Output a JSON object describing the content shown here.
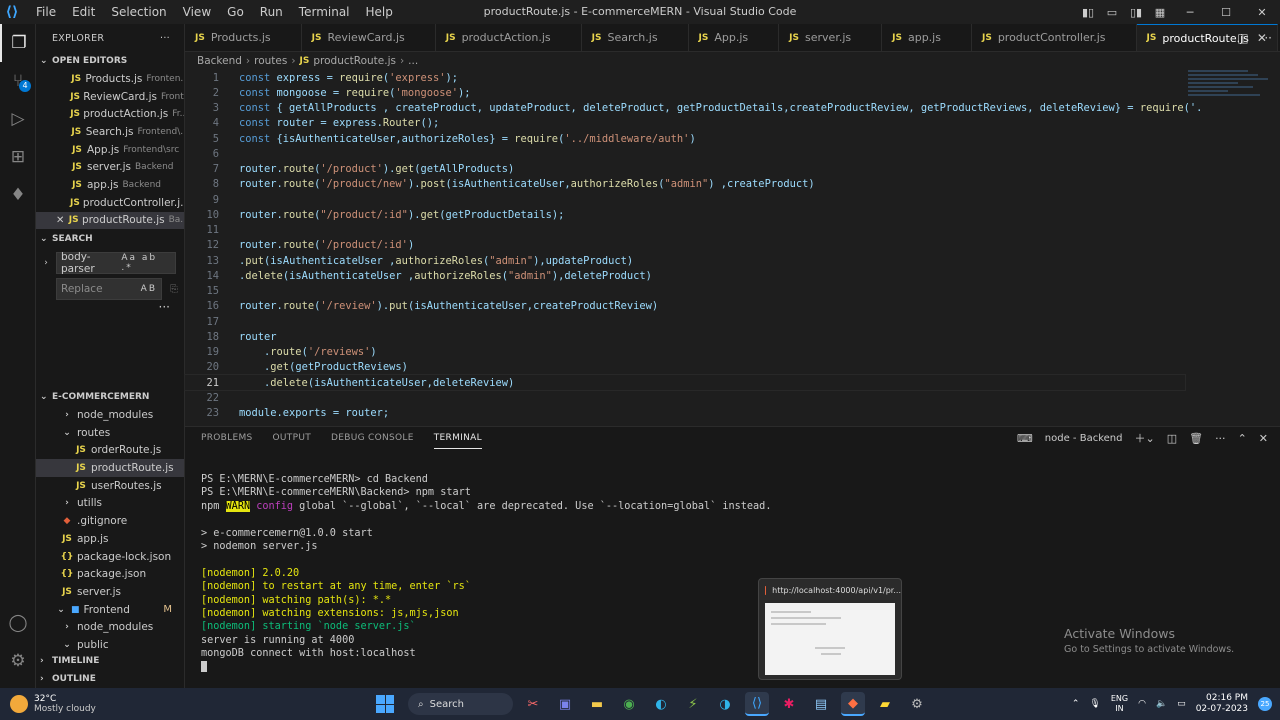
{
  "window": {
    "title": "productRoute.js - E-commerceMERN - Visual Studio Code",
    "menu": [
      "File",
      "Edit",
      "Selection",
      "View",
      "Go",
      "Run",
      "Terminal",
      "Help"
    ]
  },
  "sidebar": {
    "explorer_label": "EXPLORER",
    "open_editors_label": "OPEN EDITORS",
    "open_editors": [
      {
        "name": "Products.js",
        "path": "Fronten..."
      },
      {
        "name": "ReviewCard.js",
        "path": "Front..."
      },
      {
        "name": "productAction.js",
        "path": "Fr..."
      },
      {
        "name": "Search.js",
        "path": "Frontend\\..."
      },
      {
        "name": "App.js",
        "path": "Frontend\\src"
      },
      {
        "name": "server.js",
        "path": "Backend"
      },
      {
        "name": "app.js",
        "path": "Backend"
      },
      {
        "name": "productController.j...",
        "path": ""
      },
      {
        "name": "productRoute.js",
        "path": "Ba..."
      }
    ],
    "search_label": "SEARCH",
    "search_value": "body-parser",
    "search_opts": "Aa ab .*",
    "replace_placeholder": "Replace",
    "replace_opt": "AB",
    "project_label": "E-COMMERCEMERN",
    "tree": [
      {
        "name": "node_modules",
        "kind": "folder",
        "depth": 1
      },
      {
        "name": "routes",
        "kind": "folder-open",
        "depth": 1
      },
      {
        "name": "orderRoute.js",
        "kind": "js",
        "depth": 2
      },
      {
        "name": "productRoute.js",
        "kind": "js",
        "depth": 2
      },
      {
        "name": "userRoutes.js",
        "kind": "js",
        "depth": 2
      },
      {
        "name": "utills",
        "kind": "folder",
        "depth": 1
      },
      {
        "name": ".gitignore",
        "kind": "git",
        "depth": 1
      },
      {
        "name": "app.js",
        "kind": "js",
        "depth": 1
      },
      {
        "name": "package-lock.json",
        "kind": "json",
        "depth": 1
      },
      {
        "name": "package.json",
        "kind": "json",
        "depth": 1
      },
      {
        "name": "server.js",
        "kind": "js",
        "depth": 1
      },
      {
        "name": "Frontend",
        "kind": "folder-root",
        "depth": 0,
        "badge": "M"
      },
      {
        "name": "node_modules",
        "kind": "folder",
        "depth": 1
      },
      {
        "name": "public",
        "kind": "folder-open",
        "depth": 1
      }
    ],
    "timeline_label": "TIMELINE",
    "outline_label": "OUTLINE"
  },
  "tabs": [
    {
      "label": "Products.js"
    },
    {
      "label": "ReviewCard.js"
    },
    {
      "label": "productAction.js"
    },
    {
      "label": "Search.js"
    },
    {
      "label": "App.js"
    },
    {
      "label": "server.js"
    },
    {
      "label": "app.js"
    },
    {
      "label": "productController.js"
    },
    {
      "label": "productRoute.js",
      "active": true
    }
  ],
  "breadcrumb": [
    "Backend",
    "routes",
    "productRoute.js",
    "..."
  ],
  "code": {
    "current_line": 21,
    "lines": [
      "const express = require('express');",
      "const mongoose = require('mongoose');",
      "const { getAllProducts , createProduct, updateProduct, deleteProduct, getProductDetails,createProductReview, getProductReviews, deleteReview} = require('.",
      "const router = express.Router();",
      "const {isAuthenticateUser,authorizeRoles} = require('../middleware/auth')",
      "",
      "router.route('/product').get(getAllProducts)",
      "router.route('/product/new').post(isAuthenticateUser,authorizeRoles(\"admin\") ,createProduct)",
      "",
      "router.route(\"/product/:id\").get(getProductDetails);",
      "",
      "router.route('/product/:id')",
      ".put(isAuthenticateUser ,authorizeRoles(\"admin\"),updateProduct)",
      ".delete(isAuthenticateUser ,authorizeRoles(\"admin\"),deleteProduct)",
      "",
      "router.route('/review').put(isAuthenticateUser,createProductReview)",
      "",
      "router",
      "    .route('/reviews')",
      "    .get(getProductReviews)",
      "    .delete(isAuthenticateUser,deleteReview)",
      "",
      "module.exports = router;"
    ]
  },
  "panel": {
    "tabs": [
      "PROBLEMS",
      "OUTPUT",
      "DEBUG CONSOLE",
      "TERMINAL"
    ],
    "active_tab": "TERMINAL",
    "terminal_name": "node - Backend",
    "terminal_lines": [
      "PS E:\\MERN\\E-commerceMERN> cd Backend",
      "PS E:\\MERN\\E-commerceMERN\\Backend> npm start",
      "npm WARN config global `--global`, `--local` are deprecated. Use `--location=global` instead.",
      "",
      "> e-commercemern@1.0.0 start",
      "> nodemon server.js",
      "",
      "[nodemon] 2.0.20",
      "[nodemon] to restart at any time, enter `rs`",
      "[nodemon] watching path(s): *.*",
      "[nodemon] watching extensions: js,mjs,json",
      "[nodemon] starting `node server.js`",
      "server is running at 4000",
      "mongoDB connect with host:localhost"
    ]
  },
  "watermark": {
    "line1": "Activate Windows",
    "line2": "Go to Settings to activate Windows."
  },
  "preview": {
    "url": "http://localhost:4000/api/v1/pr..."
  },
  "taskbar": {
    "weather_temp": "32°C",
    "weather_desc": "Mostly cloudy",
    "search_label": "Search",
    "lang_1": "ENG",
    "lang_2": "IN",
    "time": "02:16 PM",
    "date": "02-07-2023",
    "notifications": "25"
  }
}
